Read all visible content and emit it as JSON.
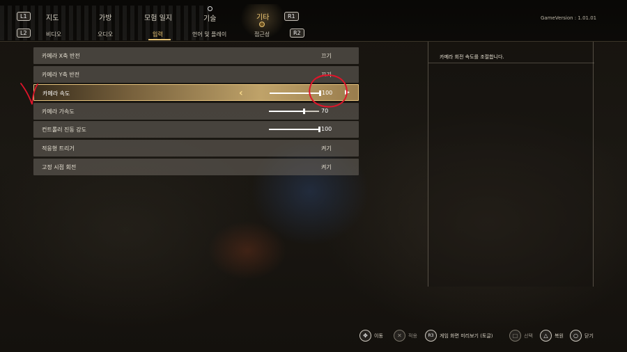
{
  "header": {
    "left_bumper": "L1",
    "right_bumper": "R1",
    "left_trigger": "L2",
    "right_trigger": "R2",
    "game_version": "GameVersion : 1.01.01",
    "tabs": [
      {
        "label": "지도"
      },
      {
        "label": "가방"
      },
      {
        "label": "모험 일지"
      },
      {
        "label": "기술"
      },
      {
        "label": "기타"
      }
    ],
    "active_tab": "기타",
    "subtabs": [
      {
        "label": "비디오"
      },
      {
        "label": "오디오"
      },
      {
        "label": "입력"
      },
      {
        "label": "언어 및 플레이"
      },
      {
        "label": "접근성"
      }
    ],
    "active_subtab": "입력"
  },
  "settings": [
    {
      "label": "카메라 X축 반전",
      "value": "끄기"
    },
    {
      "label": "카메라 Y축 반전",
      "value": "끄기"
    },
    {
      "label": "카메라 속도",
      "value": "100",
      "slider": 100
    },
    {
      "label": "카메라 가속도",
      "value": "70",
      "slider": 70
    },
    {
      "label": "컨트롤러 진동 강도",
      "value": "100",
      "slider": 100
    },
    {
      "label": "적응형 트리거",
      "value": "켜기"
    },
    {
      "label": "고정 시점 회전",
      "value": "켜기"
    }
  ],
  "selected_setting": "카메라 속도",
  "description": "카메라 회전 속도를 조절합니다.",
  "hints": [
    {
      "icon": "dpad-icon",
      "glyph": "✥",
      "label": "이동"
    },
    {
      "icon": "cross-icon",
      "glyph": "✕",
      "label": "적용"
    },
    {
      "icon": "r3-icon",
      "glyph": "R3",
      "label": "게임 화면 미리보기 (토글)"
    },
    {
      "icon": "square-icon",
      "glyph": "□",
      "label": "선택"
    },
    {
      "icon": "triangle-icon",
      "glyph": "△",
      "label": "복원"
    },
    {
      "icon": "circle-icon",
      "glyph": "○",
      "label": "닫기"
    }
  ],
  "colors": {
    "accent": "#f0c873",
    "annotation": "#e0142a"
  }
}
